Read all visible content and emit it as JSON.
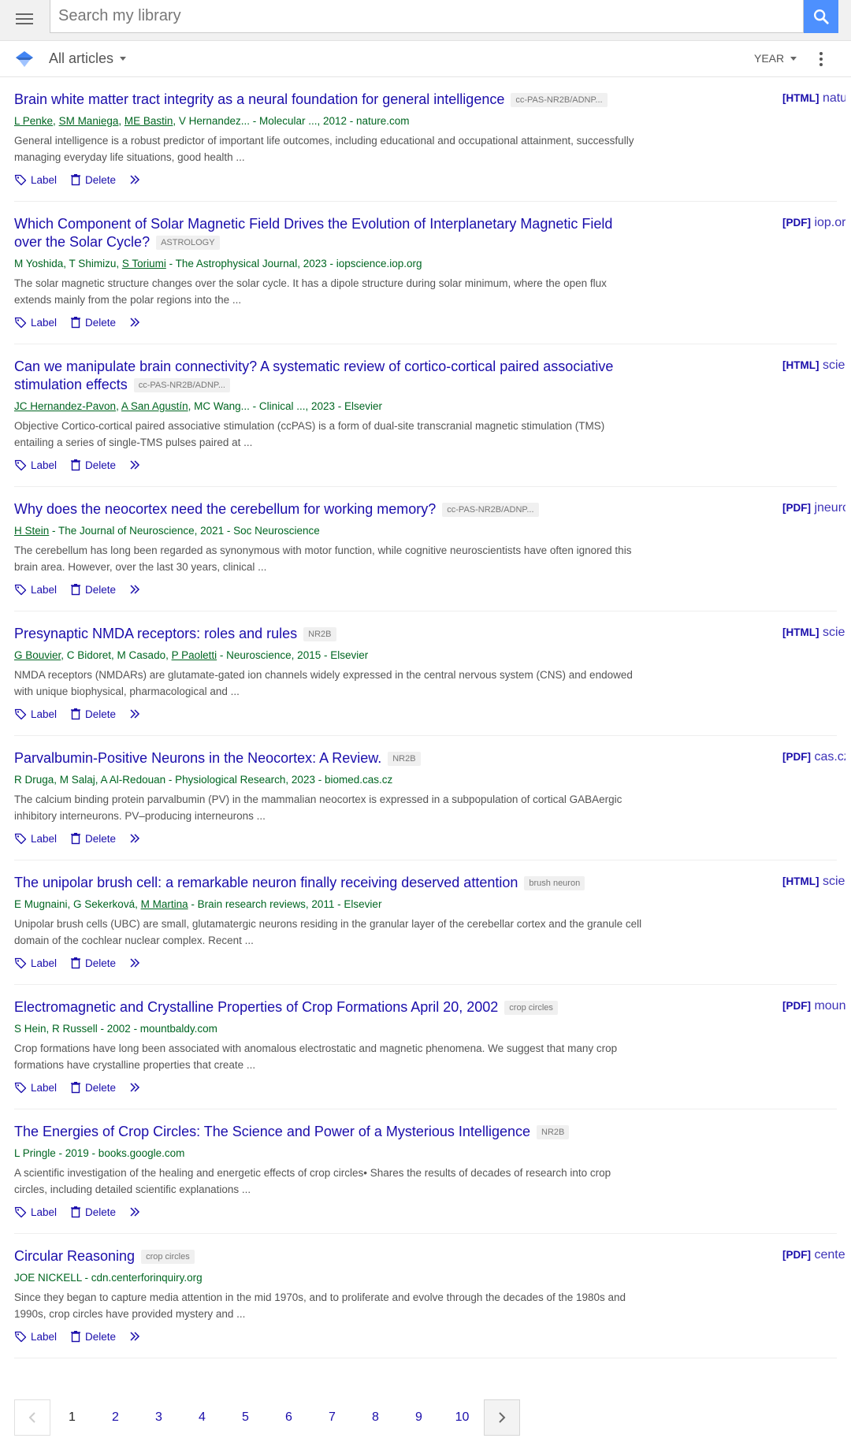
{
  "search": {
    "placeholder": "Search my library"
  },
  "filter": {
    "scope_label": "All articles",
    "year_label": "YEAR"
  },
  "actions": {
    "label": "Label",
    "delete": "Delete"
  },
  "results": [
    {
      "title": "Brain white matter tract integrity as a neural foundation for general intelligence",
      "tag": "cc-PAS-NR2B/ADNP...",
      "authors_linked": [
        "L Penke",
        "SM Maniega",
        "ME Bastin"
      ],
      "authors_rest": ", V Hernandez... - Molecular ..., 2012 - nature.com",
      "snippet": "General intelligence is a robust predictor of important life outcomes, including educational and occupational attainment, successfully managing everyday life situations, good health ...",
      "side_type": "[HTML]",
      "side_domain": "nature.com"
    },
    {
      "title": "Which Component of Solar Magnetic Field Drives the Evolution of Interplanetary Magnetic Field over the Solar Cycle?",
      "tag": "ASTROLOGY",
      "authors_pre": "M Yoshida, T Shimizu, ",
      "authors_linked": [
        "S Toriumi"
      ],
      "authors_rest": " - The Astrophysical Journal, 2023 - iopscience.iop.org",
      "snippet": "The solar magnetic structure changes over the solar cycle. It has a dipole structure during solar minimum, where the open flux extends mainly from the polar regions into the ...",
      "side_type": "[PDF]",
      "side_domain": "iop.org"
    },
    {
      "title": "Can we manipulate brain connectivity? A systematic review of cortico-cortical paired associative stimulation effects",
      "tag": "cc-PAS-NR2B/ADNP...",
      "authors_linked": [
        "JC Hernandez-Pavon",
        "A San Agustín"
      ],
      "authors_rest": ", MC Wang... - Clinical ..., 2023 - Elsevier",
      "snippet": "Objective Cortico-cortical paired associative stimulation (ccPAS) is a form of dual-site transcranial magnetic stimulation (TMS) entailing a series of single-TMS pulses paired at ...",
      "side_type": "[HTML]",
      "side_domain": "sciencedirect.com"
    },
    {
      "title": "Why does the neocortex need the cerebellum for working memory?",
      "tag": "cc-PAS-NR2B/ADNP...",
      "authors_linked": [
        "H Stein"
      ],
      "authors_rest": " - The Journal of Neuroscience, 2021 - Soc Neuroscience",
      "snippet": "The cerebellum has long been regarded as synonymous with motor function, while cognitive neuroscientists have often ignored this brain area. However, over the last 30 years, clinical ...",
      "side_type": "[PDF]",
      "side_domain": "jneurosci.org"
    },
    {
      "title": "Presynaptic NMDA receptors: roles and rules",
      "tag": "NR2B",
      "authors_linked": [
        "G Bouvier"
      ],
      "authors_mid": ", C Bidoret, M Casado, ",
      "authors_linked2": [
        "P Paoletti"
      ],
      "authors_rest": " - Neuroscience, 2015 - Elsevier",
      "snippet": "NMDA receptors (NMDARs) are glutamate-gated ion channels widely expressed in the central nervous system (CNS) and endowed with unique biophysical, pharmacological and ...",
      "side_type": "[HTML]",
      "side_domain": "sciencedirect.com"
    },
    {
      "title": "Parvalbumin-Positive Neurons in the Neocortex: A Review.",
      "tag": "NR2B",
      "authors_pre": "R Druga, M Salaj, A Al-Redouan - Physiological Research, 2023 - biomed.cas.cz",
      "snippet": "The calcium binding protein parvalbumin (PV) in the mammalian neocortex is expressed in a subpopulation of cortical GABAergic inhibitory interneurons. PV–producing interneurons ...",
      "side_type": "[PDF]",
      "side_domain": "cas.cz"
    },
    {
      "title": "The unipolar brush cell: a remarkable neuron finally receiving deserved attention",
      "tag": "brush neuron",
      "authors_pre": "E Mugnaini, G Sekerková, ",
      "authors_linked": [
        "M Martina"
      ],
      "authors_rest": " - Brain research reviews, 2011 - Elsevier",
      "snippet": "Unipolar brush cells (UBC) are small, glutamatergic neurons residing in the granular layer of the cerebellar cortex and the granule cell domain of the cochlear nuclear complex. Recent ...",
      "side_type": "[HTML]",
      "side_domain": "sciencedirect.com"
    },
    {
      "title": "Electromagnetic and Crystalline Properties of Crop Formations April 20, 2002",
      "tag": "crop circles",
      "authors_pre": "S Hein, R Russell - 2002 - mountbaldy.com",
      "snippet": "Crop formations have long been associated with anomalous electrostatic and magnetic phenomena. We suggest that many crop formations have crystalline properties that create ...",
      "side_type": "[PDF]",
      "side_domain": "mountbaldy.com"
    },
    {
      "title": "The Energies of Crop Circles: The Science and Power of a Mysterious Intelligence",
      "tag": "NR2B",
      "authors_pre": "L Pringle - 2019 - books.google.com",
      "snippet": "A scientific investigation of the healing and energetic effects of crop circles• Shares the results of decades of research into crop circles, including detailed scientific explanations ...",
      "side_type": "",
      "side_domain": ""
    },
    {
      "title": "Circular Reasoning",
      "tag": "crop circles",
      "authors_pre": "JOE NICKELL - cdn.centerforinquiry.org",
      "snippet": "Since they began to capture media attention in the mid 1970s, and to proliferate and evolve through the decades of the 1980s and 1990s, crop circles have provided mystery and ...",
      "side_type": "[PDF]",
      "side_domain": "centerforinquiry.org"
    }
  ],
  "pagination": {
    "current": 1,
    "pages": [
      "1",
      "2",
      "3",
      "4",
      "5",
      "6",
      "7",
      "8",
      "9",
      "10"
    ]
  },
  "colors": {
    "link": "#1a0dab",
    "author_green": "#006621",
    "search_button": "#4d90fe"
  }
}
